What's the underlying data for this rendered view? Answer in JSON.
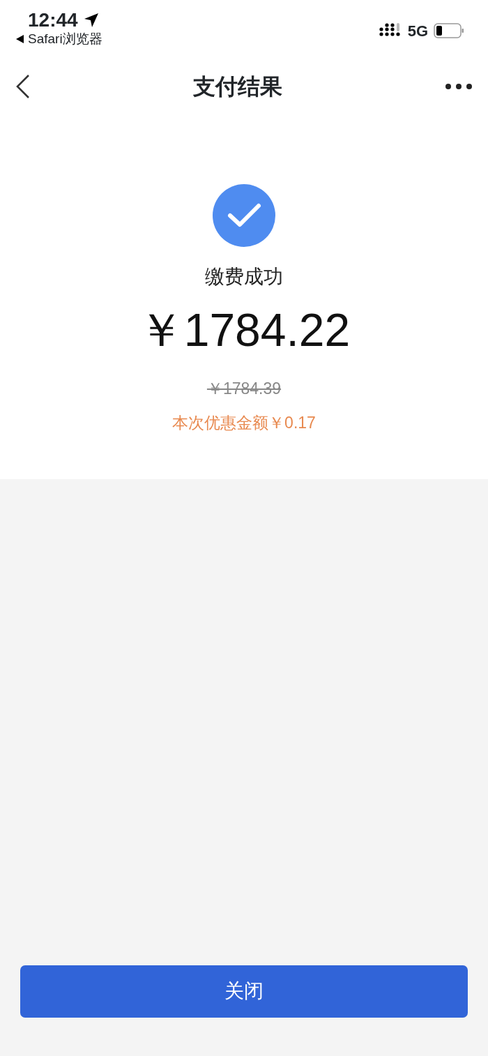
{
  "status_bar": {
    "time": "12:44",
    "back_app": "Safari浏览器",
    "network": "5G"
  },
  "nav": {
    "title": "支付结果"
  },
  "result": {
    "success": true,
    "message": "缴费成功",
    "amount": "￥1784.22",
    "original_amount": "￥1784.39",
    "discount": "本次优惠金额￥0.17"
  },
  "buttons": [
    {
      "label": "关闭"
    }
  ]
}
